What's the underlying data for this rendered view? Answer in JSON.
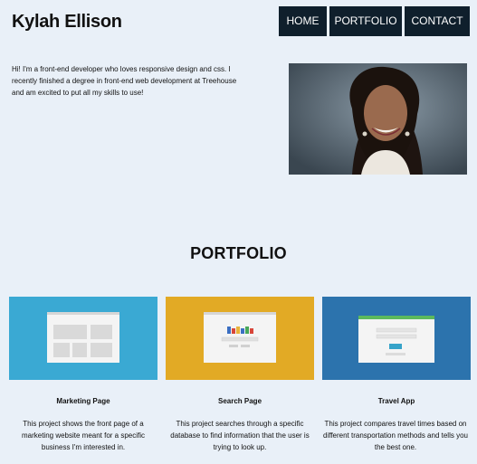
{
  "site": {
    "title": "Kylah Ellison"
  },
  "nav": [
    {
      "label": "HOME"
    },
    {
      "label": "PORTFOLIO"
    },
    {
      "label": "CONTACT"
    }
  ],
  "intro": {
    "text": "Hi! I'm a front-end developer who loves responsive design and css. I recently finished a degree in front-end web development at Treehouse and am excited to put all my skills to use!"
  },
  "portfolio": {
    "heading": "PORTFOLIO",
    "projects": [
      {
        "title": "Marketing Page",
        "description": "This project shows the front page of a marketing website meant for a specific business I'm interested in.",
        "color": "#3aa9d3"
      },
      {
        "title": "Search Page",
        "description": "This project searches through a specific database to find information that the user is trying to look up.",
        "color": "#e2aa25"
      },
      {
        "title": "Travel App",
        "description": "This project compares travel times based on different transportation methods and tells you the best one.",
        "color": "#2c73ad"
      }
    ]
  },
  "colors": {
    "nav_bg": "#0f1f2c",
    "page_bg": "#e9f0f8"
  }
}
